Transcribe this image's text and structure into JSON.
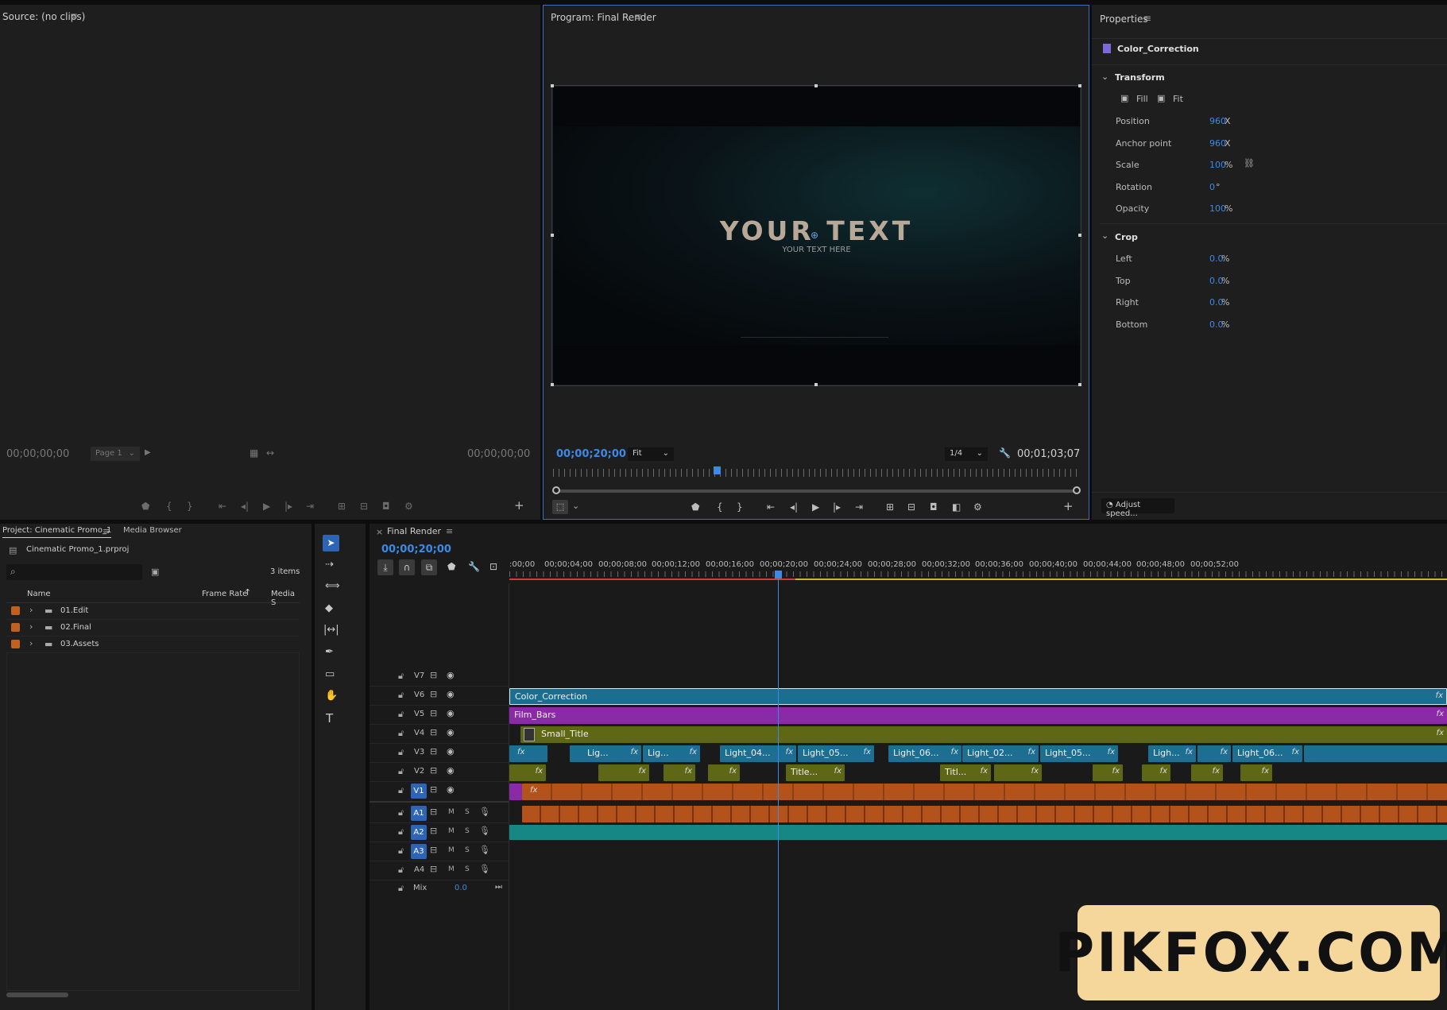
{
  "source": {
    "title": "Source: (no clips)",
    "tc_in": "00;00;00;00",
    "tc_out": "00;00;00;00",
    "page": "Page 1"
  },
  "program": {
    "title": "Program: Final Render",
    "timecode": "00;00;20;00",
    "fit": "Fit",
    "quality": "1/4",
    "duration": "00;01;03;07",
    "big_text": "YOUR TEXT",
    "sub_text": "YOUR TEXT HERE"
  },
  "properties": {
    "title": "Properties",
    "clip": "Color_Correction",
    "transform": "Transform",
    "fill": "Fill",
    "fit": "Fit",
    "rows": [
      {
        "label": "Position",
        "value": "960",
        "unit": "X"
      },
      {
        "label": "Anchor point",
        "value": "960",
        "unit": "X"
      },
      {
        "label": "Scale",
        "value": "100",
        "unit": "%"
      },
      {
        "label": "Rotation",
        "value": "0",
        "unit": "°"
      },
      {
        "label": "Opacity",
        "value": "100",
        "unit": "%"
      }
    ],
    "crop": "Crop",
    "crop_rows": [
      {
        "label": "Left",
        "value": "0.0",
        "unit": "%"
      },
      {
        "label": "Top",
        "value": "0.0",
        "unit": "%"
      },
      {
        "label": "Right",
        "value": "0.0",
        "unit": "%"
      },
      {
        "label": "Bottom",
        "value": "0.0",
        "unit": "%"
      }
    ],
    "adjust_speed": "Adjust speed..."
  },
  "project": {
    "tab1": "Project: Cinematic Promo_1",
    "tab2": "Media Browser",
    "file": "Cinematic Promo_1.prproj",
    "count": "3 items",
    "col_name": "Name",
    "col_fr": "Frame Rate",
    "col_ms": "Media S",
    "items": [
      {
        "name": "01.Edit"
      },
      {
        "name": "02.Final"
      },
      {
        "name": "03.Assets"
      }
    ]
  },
  "timeline": {
    "tab": "Final Render",
    "timecode": "00;00;20;00",
    "ruler": [
      ":00;00",
      "00;00;04;00",
      "00;00;08;00",
      "00;00;12;00",
      "00;00;16;00",
      "00;00;20;00",
      "00;00;24;00",
      "00;00;28;00",
      "00;00;32;00",
      "00;00;36;00",
      "00;00;40;00",
      "00;00;44;00",
      "00;00;48;00",
      "00;00;52;00"
    ],
    "vtracks": [
      "V7",
      "V6",
      "V5",
      "V4",
      "V3",
      "V2",
      "V1"
    ],
    "atracks": [
      "A1",
      "A2",
      "A3",
      "A4"
    ],
    "mix_label": "Mix",
    "mix_value": "0.0",
    "clips": {
      "v6": "Color_Correction",
      "v5": "Film_Bars",
      "v4": "Small_Title",
      "v3": [
        "Lig...",
        "Lig...",
        "Light_04...",
        "Light_05...",
        "Light_06...",
        "Light_02...",
        "Light_05...",
        "Ligh...",
        "Light_06..."
      ],
      "v2": [
        "Title...",
        "Titl..."
      ]
    },
    "ms": "M",
    "ss": "S"
  },
  "watermark": "PIKFOX.COM",
  "colors": {
    "v6": "#1b6e8f",
    "v5": "#8a2aa6",
    "v4": "#5d6716",
    "v3": "#1d6e93",
    "v1": "#b4521c",
    "a": "#b4521c",
    "a2": "#168785",
    "accent": "#3d8ae5"
  }
}
